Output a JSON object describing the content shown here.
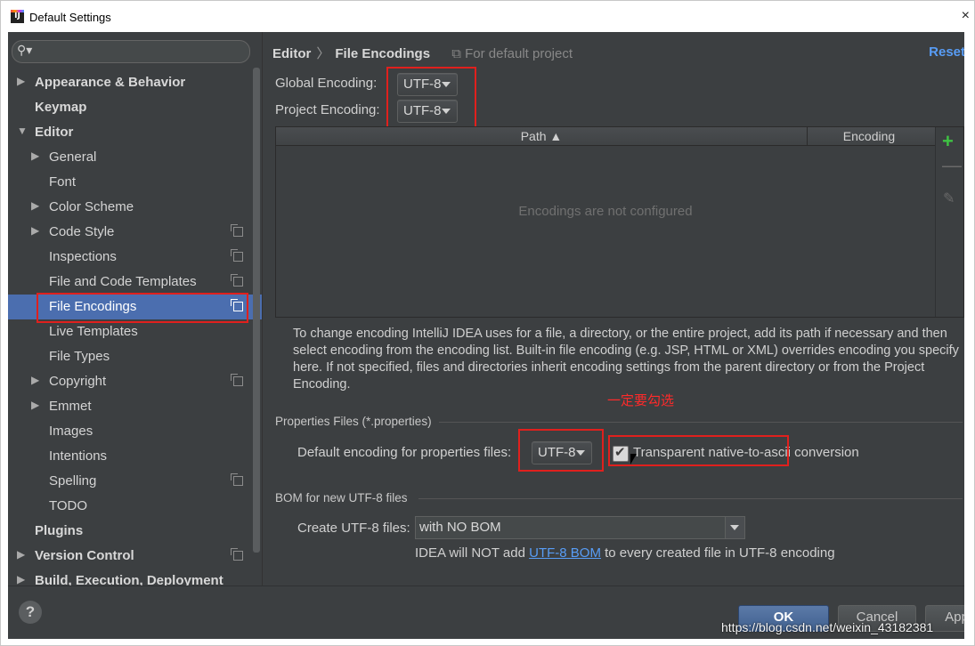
{
  "window": {
    "title": "Default Settings",
    "close": "×"
  },
  "sidebar": {
    "items": [
      {
        "label": "Appearance & Behavior",
        "arrow": "▶",
        "bold": true
      },
      {
        "label": "Keymap",
        "arrow": "",
        "bold": true
      },
      {
        "label": "Editor",
        "arrow": "▼",
        "bold": true
      },
      {
        "label": "General",
        "arrow": "▶"
      },
      {
        "label": "Font",
        "arrow": ""
      },
      {
        "label": "Color Scheme",
        "arrow": "▶"
      },
      {
        "label": "Code Style",
        "arrow": "▶",
        "copy": true
      },
      {
        "label": "Inspections",
        "arrow": "",
        "copy": true
      },
      {
        "label": "File and Code Templates",
        "arrow": "",
        "copy": true
      },
      {
        "label": "File Encodings",
        "arrow": "",
        "copy": true,
        "selected": true
      },
      {
        "label": "Live Templates",
        "arrow": ""
      },
      {
        "label": "File Types",
        "arrow": ""
      },
      {
        "label": "Copyright",
        "arrow": "▶",
        "copy": true
      },
      {
        "label": "Emmet",
        "arrow": "▶"
      },
      {
        "label": "Images",
        "arrow": ""
      },
      {
        "label": "Intentions",
        "arrow": ""
      },
      {
        "label": "Spelling",
        "arrow": "",
        "copy": true
      },
      {
        "label": "TODO",
        "arrow": ""
      },
      {
        "label": "Plugins",
        "arrow": "",
        "bold": true
      },
      {
        "label": "Version Control",
        "arrow": "▶",
        "bold": true,
        "copy": true
      },
      {
        "label": "Build, Execution, Deployment",
        "arrow": "▶",
        "bold": true
      }
    ]
  },
  "header": {
    "crumb1": "Editor",
    "sep": "〉",
    "crumb2": "File Encodings",
    "scope": "For default project",
    "reset": "Reset"
  },
  "encoding": {
    "global_label": "Global Encoding:",
    "global_value": "UTF-8",
    "project_label": "Project Encoding:",
    "project_value": "UTF-8"
  },
  "table": {
    "col_path": "Path ▲",
    "col_encoding": "Encoding",
    "empty": "Encodings are not configured"
  },
  "description": "To change encoding IntelliJ IDEA uses for a file, a directory, or the entire project, add its path if necessary and then select encoding from the encoding list. Built-in file encoding (e.g. JSP, HTML or XML) overrides encoding you specify here. If not specified, files and directories inherit encoding settings from the parent directory or from the Project Encoding.",
  "annotation": "一定要勾选",
  "properties": {
    "section": "Properties Files (*.properties)",
    "default_label": "Default encoding for properties files:",
    "default_value": "UTF-8",
    "transparent_label": "Transparent native-to-ascii conversion",
    "transparent_checked": true
  },
  "bom": {
    "section": "BOM for new UTF-8 files",
    "create_label": "Create UTF-8 files:",
    "create_value": "with NO BOM",
    "note_before": "IDEA will NOT add ",
    "note_link": "UTF-8 BOM",
    "note_after": " to every created file in UTF-8 encoding"
  },
  "footer": {
    "help": "?",
    "ok": "OK",
    "cancel": "Cancel",
    "apply": "Apply"
  },
  "watermark": "https://blog.csdn.net/weixin_43182381",
  "colors": {
    "selection": "#4b6eaf",
    "highlight": "#e0201d",
    "link": "#589df6",
    "background": "#3c3f41"
  }
}
